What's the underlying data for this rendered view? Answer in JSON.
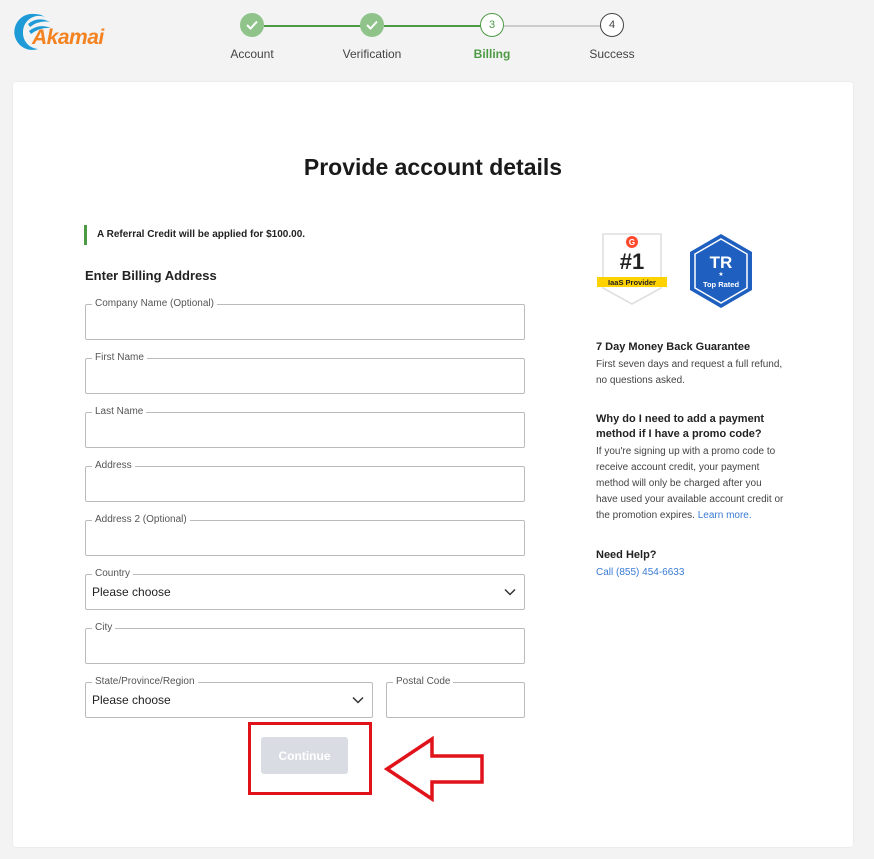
{
  "brand": {
    "logo_text": "Akamai",
    "accent": "#f58220"
  },
  "stepper": {
    "steps": [
      {
        "label": "Account",
        "state": "done",
        "number": ""
      },
      {
        "label": "Verification",
        "state": "done",
        "number": ""
      },
      {
        "label": "Billing",
        "state": "current",
        "number": "3"
      },
      {
        "label": "Success",
        "state": "todo",
        "number": "4"
      }
    ],
    "done_color": "#8fc38a",
    "active_color": "#4d9a45"
  },
  "page": {
    "title": "Provide account details",
    "referral_note": "A Referral Credit will be applied for $100.00.",
    "billing_heading": "Enter Billing Address"
  },
  "form": {
    "company": {
      "label": "Company Name (Optional)",
      "value": ""
    },
    "first_name": {
      "label": "First Name",
      "value": ""
    },
    "last_name": {
      "label": "Last Name",
      "value": ""
    },
    "address": {
      "label": "Address",
      "value": ""
    },
    "address2": {
      "label": "Address 2 (Optional)",
      "value": ""
    },
    "country": {
      "label": "Country",
      "value": "Please choose"
    },
    "city": {
      "label": "City",
      "value": ""
    },
    "state": {
      "label": "State/Province/Region",
      "value": "Please choose"
    },
    "postal": {
      "label": "Postal Code",
      "value": ""
    },
    "continue_label": "Continue"
  },
  "badges": {
    "g2_rank": "#1",
    "g2_label": "IaaS Provider",
    "tr_logo": "TR",
    "tr_label": "Top Rated"
  },
  "sidebar": {
    "guarantee_title": "7 Day Money Back Guarantee",
    "guarantee_text": "First seven days and request a full refund, no questions asked.",
    "promo_title": "Why do I need to add a payment method if I have a promo code?",
    "promo_text": "If you're signing up with a promo code to receive account credit, your payment method will only be charged after you have used your available account credit or the promotion expires.",
    "learn_more": "Learn more.",
    "help_title": "Need Help?",
    "help_phone": "Call (855) 454-6633"
  },
  "annotation": {
    "highlight_color": "#e0121a"
  }
}
